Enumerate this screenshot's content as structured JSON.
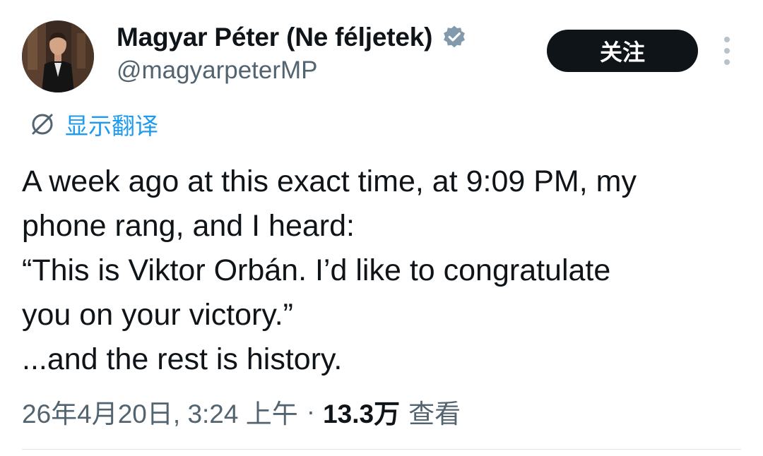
{
  "author": {
    "display_name": "Magyar Péter (Ne féljetek)",
    "handle": "@magyarpeterMP",
    "verified_icon": "verified-badge-icon"
  },
  "actions": {
    "follow_label": "关注",
    "more_icon": "more-vertical-icon"
  },
  "translate": {
    "label": "显示翻译",
    "icon": "translate-icon"
  },
  "tweet": {
    "lines": [
      "A week ago at this exact time, at 9:09 PM, my",
      "phone rang, and I heard:",
      "“This is Viktor Orbán. I’d like to congratulate",
      "you on your victory.”",
      "...and the rest is history."
    ]
  },
  "meta": {
    "timestamp": "26年4月20日, 3:24 上午",
    "separator": "·",
    "views_count": "13.3万",
    "views_label": "查看"
  },
  "colors": {
    "text_primary": "#0f1419",
    "text_secondary": "#536471",
    "link_blue": "#1d9bf0",
    "verified_grey": "#829aab",
    "button_bg": "#0f1419"
  }
}
